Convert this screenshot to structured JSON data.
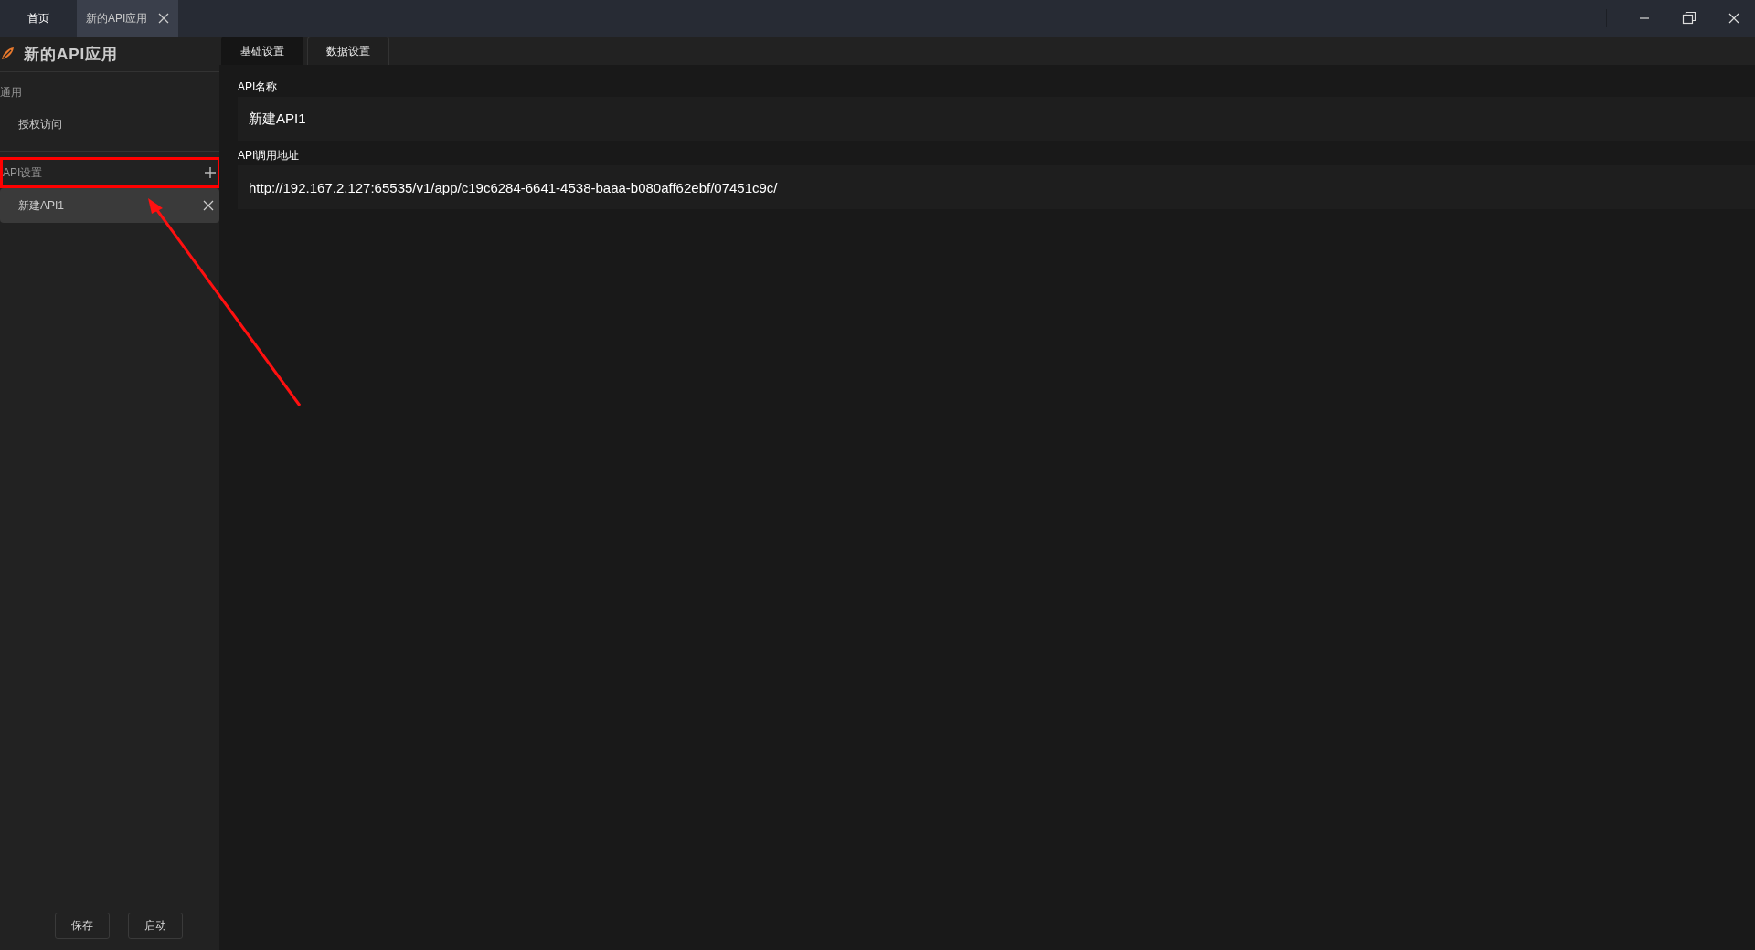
{
  "window_tabs": [
    {
      "label": "首页",
      "selected": false,
      "closable": false
    },
    {
      "label": "新的API应用",
      "selected": true,
      "closable": true
    }
  ],
  "sidebar": {
    "title": "新的API应用",
    "sections": [
      {
        "title": "通用",
        "addable": false,
        "items": [
          {
            "label": "授权访问",
            "selected": false,
            "closable": false
          }
        ]
      },
      {
        "title": "API设置",
        "addable": true,
        "highlighted": true,
        "items": [
          {
            "label": "新建API1",
            "selected": true,
            "closable": true
          }
        ]
      }
    ],
    "buttons": [
      "保存",
      "启动"
    ]
  },
  "tabs": [
    {
      "label": "基础设置",
      "selected": true
    },
    {
      "label": "数据设置",
      "selected": false
    }
  ],
  "fields": [
    {
      "label": "API名称",
      "value": "新建API1"
    },
    {
      "label": "API调用地址",
      "value": "http://192.167.2.127:65535/v1/app/c19c6284-6641-4538-baaa-b080aff62ebf/07451c9c/"
    }
  ],
  "annotation_arrow": true
}
